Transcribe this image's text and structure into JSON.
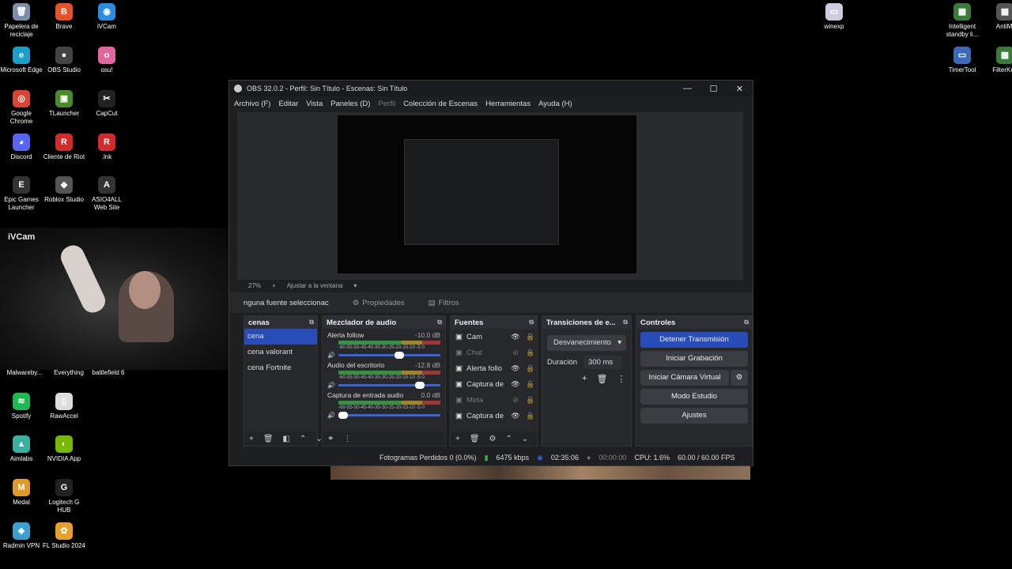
{
  "desktop_icons": [
    {
      "label": "Papelera de reciclaje",
      "icon": "recycle-bin-icon",
      "color": "#7c8ea8",
      "glyph": "🗑"
    },
    {
      "label": "Brave",
      "icon": "brave-icon",
      "color": "#e8522a",
      "glyph": "B"
    },
    {
      "label": "iVCam",
      "icon": "ivcam-icon",
      "color": "#2a8de0",
      "glyph": "◉"
    },
    {
      "label": "Microsoft Edge",
      "icon": "edge-icon",
      "color": "#1aa0c8",
      "glyph": "e"
    },
    {
      "label": "OBS Studio",
      "icon": "obs-icon",
      "color": "#444",
      "glyph": "●"
    },
    {
      "label": "osu!",
      "icon": "osu-icon",
      "color": "#e2669e",
      "glyph": "o"
    },
    {
      "label": "Google Chrome",
      "icon": "chrome-icon",
      "color": "#d94435",
      "glyph": "◎"
    },
    {
      "label": "TLauncher",
      "icon": "tlauncher-icon",
      "color": "#4a8a2a",
      "glyph": "▣"
    },
    {
      "label": "CapCut",
      "icon": "capcut-icon",
      "color": "#222",
      "glyph": "✂"
    },
    {
      "label": "Discord",
      "icon": "discord-icon",
      "color": "#5865f2",
      "glyph": "◕"
    },
    {
      "label": "Cliente de Riot",
      "icon": "riot-icon",
      "color": "#d32a2a",
      "glyph": "R"
    },
    {
      "label": ".lnk",
      "icon": "shortcut-icon",
      "color": "#d32a2a",
      "glyph": "R"
    },
    {
      "label": "Epic Games Launcher",
      "icon": "epic-icon",
      "color": "#333",
      "glyph": "E"
    },
    {
      "label": "Roblox Studio",
      "icon": "roblox-icon",
      "color": "#555",
      "glyph": "◆"
    },
    {
      "label": "ASIO4ALL Web Site",
      "icon": "asio-icon",
      "color": "#333",
      "glyph": "A"
    },
    {
      "label": "winexp",
      "icon": "winexp-icon",
      "color": "#ccd",
      "glyph": "▭"
    },
    {
      "label": "Intelligent standby li...",
      "icon": "standby-icon",
      "color": "#3a7a3a",
      "glyph": "▦"
    },
    {
      "label": "AntiMi",
      "icon": "antimi-icon",
      "color": "#555",
      "glyph": "▦"
    },
    {
      "label": "TimerTool",
      "icon": "timertool-icon",
      "color": "#3a6ab8",
      "glyph": "▭"
    },
    {
      "label": "FilterKey",
      "icon": "filterkey-icon",
      "color": "#3a7a3a",
      "glyph": "▦"
    },
    {
      "label": "Spotify",
      "icon": "spotify-icon",
      "color": "#1db954",
      "glyph": "≋"
    },
    {
      "label": "RawAccel",
      "icon": "rawaccel-icon",
      "color": "#ddd",
      "glyph": "▯"
    },
    {
      "label": "Aimlabs",
      "icon": "aimlabs-icon",
      "color": "#3ab0a0",
      "glyph": "▲"
    },
    {
      "label": "NVIDIA App",
      "icon": "nvidia-icon",
      "color": "#76b900",
      "glyph": "◐"
    },
    {
      "label": "Medal",
      "icon": "medal-icon",
      "color": "#e09a2a",
      "glyph": "M"
    },
    {
      "label": "Logitech G HUB",
      "icon": "ghub-icon",
      "color": "#222",
      "glyph": "G"
    },
    {
      "label": "Radmin VPN",
      "icon": "radmin-icon",
      "color": "#3aa0d0",
      "glyph": "◈"
    },
    {
      "label": "FL Studio 2024",
      "icon": "flstudio-icon",
      "color": "#e8a02a",
      "glyph": "✿"
    }
  ],
  "desktop_partial_labels": [
    "Malwareby...",
    "Everything",
    "battlefield 6"
  ],
  "webcam": {
    "label": "iVCam"
  },
  "obs": {
    "title": "OBS 32.0.2 - Perfil: Sin Título - Escenas: Sin Título",
    "menu": [
      "Archivo (F)",
      "Editar",
      "Vista",
      "Paneles (D)",
      "Perfil",
      "Colección de Escenas",
      "Herramientas",
      "Ayuda (H)"
    ],
    "zoom": "27%",
    "zoom_add": "+",
    "fit_label": "Ajustar a la ventana",
    "no_source": "nguna fuente seleccionac",
    "properties_label": "Propiedades",
    "filters_label": "Filtros",
    "scenes_title": "cenas",
    "scenes": [
      "cena",
      "cena valorant",
      "cena Fortnite"
    ],
    "mixer_title": "Mezclador de audio",
    "mixer": [
      {
        "name": "Alerta follow",
        "db": "-10.0 dB",
        "level": 0.55
      },
      {
        "name": "Audio del escritorio",
        "db": "-12.8 dB",
        "level": 0.75
      },
      {
        "name": "Captura de entrada audio",
        "db": "0.0 dB",
        "level": 0.0
      }
    ],
    "meter_ticks": "-60-55-50-45-40-35-30-25-20-15-10 -5  0",
    "sources_title": "Fuentes",
    "sources": [
      {
        "name": "Cam",
        "visible": true
      },
      {
        "name": "Chat",
        "visible": false
      },
      {
        "name": "Alerta follo",
        "visible": true
      },
      {
        "name": "Captura de",
        "visible": true
      },
      {
        "name": "Meta",
        "visible": false
      },
      {
        "name": "Captura de",
        "visible": true
      }
    ],
    "transitions_title": "Transiciones de e...",
    "transition": "Desvanecimiento",
    "duration_label": "Duración",
    "duration_value": "300 ms",
    "controls_title": "Controles",
    "controls": {
      "stop_stream": "Detener Transmisión",
      "start_record": "Iniciar Grabación",
      "virtual_cam": "Iniciar Cámara Virtual",
      "studio_mode": "Modo Estudio",
      "settings": "Ajustes"
    },
    "status": {
      "dropped": "Fotogramas Perdidos 0 (0.0%)",
      "bitrate": "6475 kbps",
      "stream_time": "02:35:06",
      "record_time": "00:00:00",
      "cpu": "CPU: 1.6%",
      "fps": "60.00 / 60.00 FPS"
    }
  }
}
